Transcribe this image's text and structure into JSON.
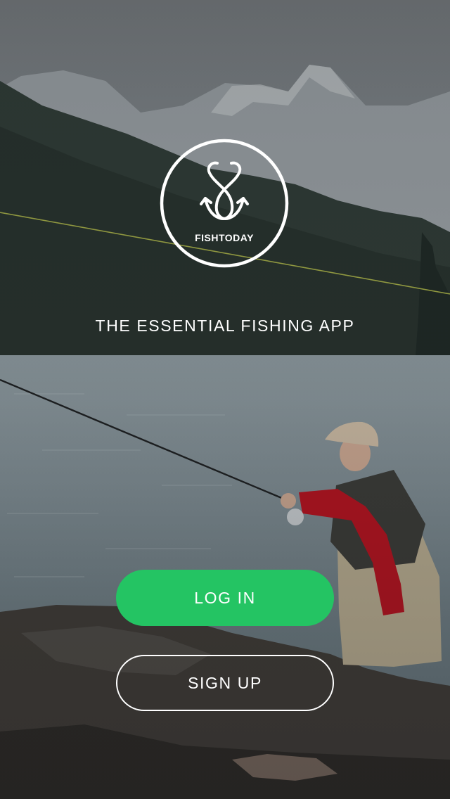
{
  "brand": {
    "name": "FISHTODAY",
    "tagline": "THE ESSENTIAL FISHING APP"
  },
  "actions": {
    "login_label": "LOG IN",
    "signup_label": "SIGN UP"
  },
  "colors": {
    "accent": "#24c463",
    "text": "#ffffff",
    "fishing_line": "#b9c14a"
  },
  "icons": {
    "logo": "fish-hooks-icon"
  },
  "background": {
    "image": "fly-fisherman-mountain-lake-photo"
  }
}
